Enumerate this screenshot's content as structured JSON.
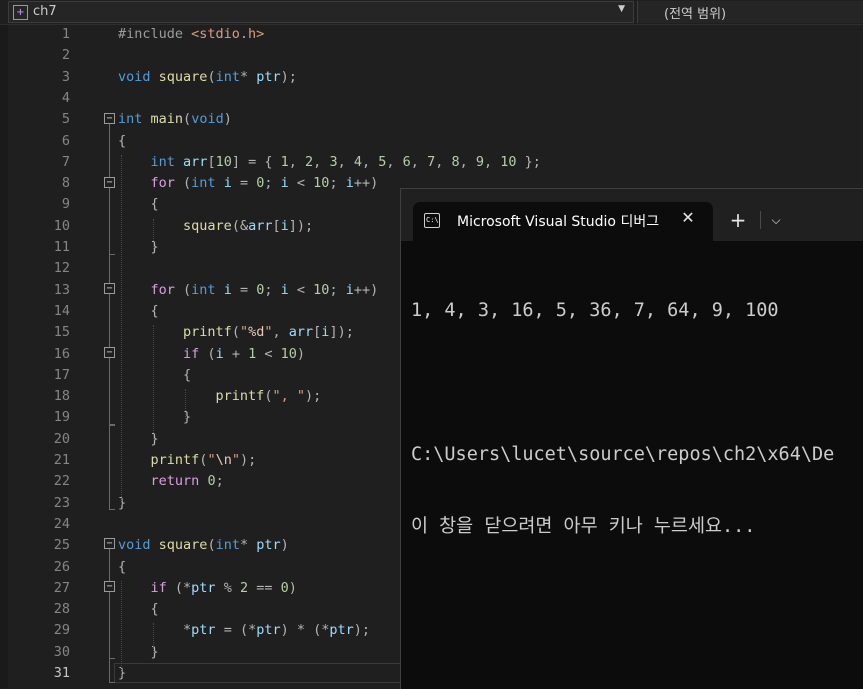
{
  "navbar": {
    "project_name": "ch7",
    "scope": "(전역 범위)"
  },
  "editor": {
    "current_line": 31,
    "lines": [
      {
        "n": "1",
        "tokens": [
          [
            "pp",
            "#include "
          ],
          [
            "str",
            "<stdio.h>"
          ]
        ]
      },
      {
        "n": "2",
        "tokens": []
      },
      {
        "n": "3",
        "tokens": [
          [
            "kw",
            "void"
          ],
          [
            "",
            " "
          ],
          [
            "fn",
            "square"
          ],
          [
            "op",
            "("
          ],
          [
            "kw",
            "int"
          ],
          [
            "op",
            "* "
          ],
          [
            "var",
            "ptr"
          ],
          [
            "op",
            ");"
          ]
        ]
      },
      {
        "n": "4",
        "tokens": []
      },
      {
        "n": "5",
        "tokens": [
          [
            "kw",
            "int"
          ],
          [
            "",
            " "
          ],
          [
            "fn",
            "main"
          ],
          [
            "op",
            "("
          ],
          [
            "kw",
            "void"
          ],
          [
            "op",
            ")"
          ]
        ]
      },
      {
        "n": "6",
        "tokens": [
          [
            "op",
            "{"
          ]
        ]
      },
      {
        "n": "7",
        "tokens": [
          [
            "",
            "    "
          ],
          [
            "kw",
            "int"
          ],
          [
            "",
            " "
          ],
          [
            "var",
            "arr"
          ],
          [
            "op",
            "["
          ],
          [
            "num",
            "10"
          ],
          [
            "op",
            "] = { "
          ],
          [
            "num",
            "1"
          ],
          [
            "op",
            ", "
          ],
          [
            "num",
            "2"
          ],
          [
            "op",
            ", "
          ],
          [
            "num",
            "3"
          ],
          [
            "op",
            ", "
          ],
          [
            "num",
            "4"
          ],
          [
            "op",
            ", "
          ],
          [
            "num",
            "5"
          ],
          [
            "op",
            ", "
          ],
          [
            "num",
            "6"
          ],
          [
            "op",
            ", "
          ],
          [
            "num",
            "7"
          ],
          [
            "op",
            ", "
          ],
          [
            "num",
            "8"
          ],
          [
            "op",
            ", "
          ],
          [
            "num",
            "9"
          ],
          [
            "op",
            ", "
          ],
          [
            "num",
            "10"
          ],
          [
            "op",
            " };"
          ]
        ]
      },
      {
        "n": "8",
        "tokens": [
          [
            "",
            "    "
          ],
          [
            "ctl",
            "for"
          ],
          [
            "op",
            " ("
          ],
          [
            "kw",
            "int"
          ],
          [
            "",
            " "
          ],
          [
            "var",
            "i"
          ],
          [
            "op",
            " = "
          ],
          [
            "num",
            "0"
          ],
          [
            "op",
            "; "
          ],
          [
            "var",
            "i"
          ],
          [
            "op",
            " < "
          ],
          [
            "num",
            "10"
          ],
          [
            "op",
            "; "
          ],
          [
            "var",
            "i"
          ],
          [
            "op",
            "++)"
          ]
        ]
      },
      {
        "n": "9",
        "tokens": [
          [
            "",
            "    "
          ],
          [
            "op",
            "{"
          ]
        ]
      },
      {
        "n": "10",
        "tokens": [
          [
            "",
            "        "
          ],
          [
            "fn",
            "square"
          ],
          [
            "op",
            "(&"
          ],
          [
            "var",
            "arr"
          ],
          [
            "op",
            "["
          ],
          [
            "var",
            "i"
          ],
          [
            "op",
            "]);"
          ]
        ]
      },
      {
        "n": "11",
        "tokens": [
          [
            "",
            "    "
          ],
          [
            "op",
            "}"
          ]
        ]
      },
      {
        "n": "12",
        "tokens": []
      },
      {
        "n": "13",
        "tokens": [
          [
            "",
            "    "
          ],
          [
            "ctl",
            "for"
          ],
          [
            "op",
            " ("
          ],
          [
            "kw",
            "int"
          ],
          [
            "",
            " "
          ],
          [
            "var",
            "i"
          ],
          [
            "op",
            " = "
          ],
          [
            "num",
            "0"
          ],
          [
            "op",
            "; "
          ],
          [
            "var",
            "i"
          ],
          [
            "op",
            " < "
          ],
          [
            "num",
            "10"
          ],
          [
            "op",
            "; "
          ],
          [
            "var",
            "i"
          ],
          [
            "op",
            "++)"
          ]
        ]
      },
      {
        "n": "14",
        "tokens": [
          [
            "",
            "    "
          ],
          [
            "op",
            "{"
          ]
        ]
      },
      {
        "n": "15",
        "tokens": [
          [
            "",
            "        "
          ],
          [
            "fn",
            "printf"
          ],
          [
            "op",
            "("
          ],
          [
            "str",
            "\""
          ],
          [
            "esc",
            "%d"
          ],
          [
            "str",
            "\""
          ],
          [
            "op",
            ", "
          ],
          [
            "var",
            "arr"
          ],
          [
            "op",
            "["
          ],
          [
            "var",
            "i"
          ],
          [
            "op",
            "]);"
          ]
        ]
      },
      {
        "n": "16",
        "tokens": [
          [
            "",
            "        "
          ],
          [
            "ctl",
            "if"
          ],
          [
            "op",
            " ("
          ],
          [
            "var",
            "i"
          ],
          [
            "op",
            " + "
          ],
          [
            "num",
            "1"
          ],
          [
            "op",
            " < "
          ],
          [
            "num",
            "10"
          ],
          [
            "op",
            ")"
          ]
        ]
      },
      {
        "n": "17",
        "tokens": [
          [
            "",
            "        "
          ],
          [
            "op",
            "{"
          ]
        ]
      },
      {
        "n": "18",
        "tokens": [
          [
            "",
            "            "
          ],
          [
            "fn",
            "printf"
          ],
          [
            "op",
            "("
          ],
          [
            "str",
            "\", \""
          ],
          [
            "op",
            ");"
          ]
        ]
      },
      {
        "n": "19",
        "tokens": [
          [
            "",
            "        "
          ],
          [
            "op",
            "}"
          ]
        ]
      },
      {
        "n": "20",
        "tokens": [
          [
            "",
            "    "
          ],
          [
            "op",
            "}"
          ]
        ]
      },
      {
        "n": "21",
        "tokens": [
          [
            "",
            "    "
          ],
          [
            "fn",
            "printf"
          ],
          [
            "op",
            "("
          ],
          [
            "str",
            "\""
          ],
          [
            "esc",
            "\\n"
          ],
          [
            "str",
            "\""
          ],
          [
            "op",
            ");"
          ]
        ]
      },
      {
        "n": "22",
        "tokens": [
          [
            "",
            "    "
          ],
          [
            "ctl",
            "return"
          ],
          [
            "",
            " "
          ],
          [
            "num",
            "0"
          ],
          [
            "op",
            ";"
          ]
        ]
      },
      {
        "n": "23",
        "tokens": [
          [
            "op",
            "}"
          ]
        ]
      },
      {
        "n": "24",
        "tokens": []
      },
      {
        "n": "25",
        "tokens": [
          [
            "kw",
            "void"
          ],
          [
            "",
            " "
          ],
          [
            "fn",
            "square"
          ],
          [
            "op",
            "("
          ],
          [
            "kw",
            "int"
          ],
          [
            "op",
            "* "
          ],
          [
            "var",
            "ptr"
          ],
          [
            "op",
            ")"
          ]
        ]
      },
      {
        "n": "26",
        "tokens": [
          [
            "op",
            "{"
          ]
        ]
      },
      {
        "n": "27",
        "tokens": [
          [
            "",
            "    "
          ],
          [
            "ctl",
            "if"
          ],
          [
            "op",
            " (*"
          ],
          [
            "var",
            "ptr"
          ],
          [
            "op",
            " % "
          ],
          [
            "num",
            "2"
          ],
          [
            "op",
            " == "
          ],
          [
            "num",
            "0"
          ],
          [
            "op",
            ")"
          ]
        ]
      },
      {
        "n": "28",
        "tokens": [
          [
            "",
            "    "
          ],
          [
            "op",
            "{"
          ]
        ]
      },
      {
        "n": "29",
        "tokens": [
          [
            "",
            "        "
          ],
          [
            "op",
            "*"
          ],
          [
            "var",
            "ptr"
          ],
          [
            "op",
            " = (*"
          ],
          [
            "var",
            "ptr"
          ],
          [
            "op",
            ") * (*"
          ],
          [
            "var",
            "ptr"
          ],
          [
            "op",
            ");"
          ]
        ]
      },
      {
        "n": "30",
        "tokens": [
          [
            "",
            "    "
          ],
          [
            "op",
            "}"
          ]
        ]
      },
      {
        "n": "31",
        "tokens": [
          [
            "op",
            "}"
          ]
        ]
      }
    ]
  },
  "console": {
    "tab_title": "Microsoft Visual Studio 디버그",
    "icon_text": "C:\\",
    "close_symbol": "✕",
    "new_tab_symbol": "+",
    "dropdown_symbol": "⌵",
    "output_lines": [
      "1, 4, 3, 16, 5, 36, 7, 64, 9, 100",
      "",
      "C:\\Users\\lucet\\source\\repos\\ch2\\x64\\De",
      "이 창을 닫으려면 아무 키나 누르세요..."
    ]
  }
}
